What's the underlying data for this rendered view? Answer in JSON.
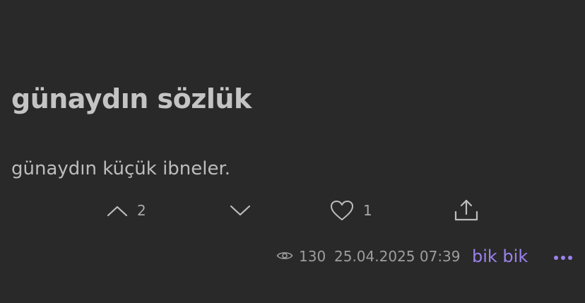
{
  "entry": {
    "title": "günaydın sözlük",
    "text": "günaydın küçük ibneler."
  },
  "actions": {
    "upvote_count": "2",
    "like_count": "1"
  },
  "meta": {
    "views": "130",
    "timestamp": "25.04.2025 07:39",
    "author": "bik bik"
  },
  "icons": {
    "upvote": "chevron-up-icon",
    "downvote": "chevron-down-icon",
    "like": "heart-icon",
    "share": "share-icon",
    "views": "eye-icon",
    "more": "more-dots-icon"
  },
  "colors": {
    "background": "#292929",
    "text": "#c4c4c4",
    "muted": "#9e9e9e",
    "accent": "#9b82ec"
  }
}
